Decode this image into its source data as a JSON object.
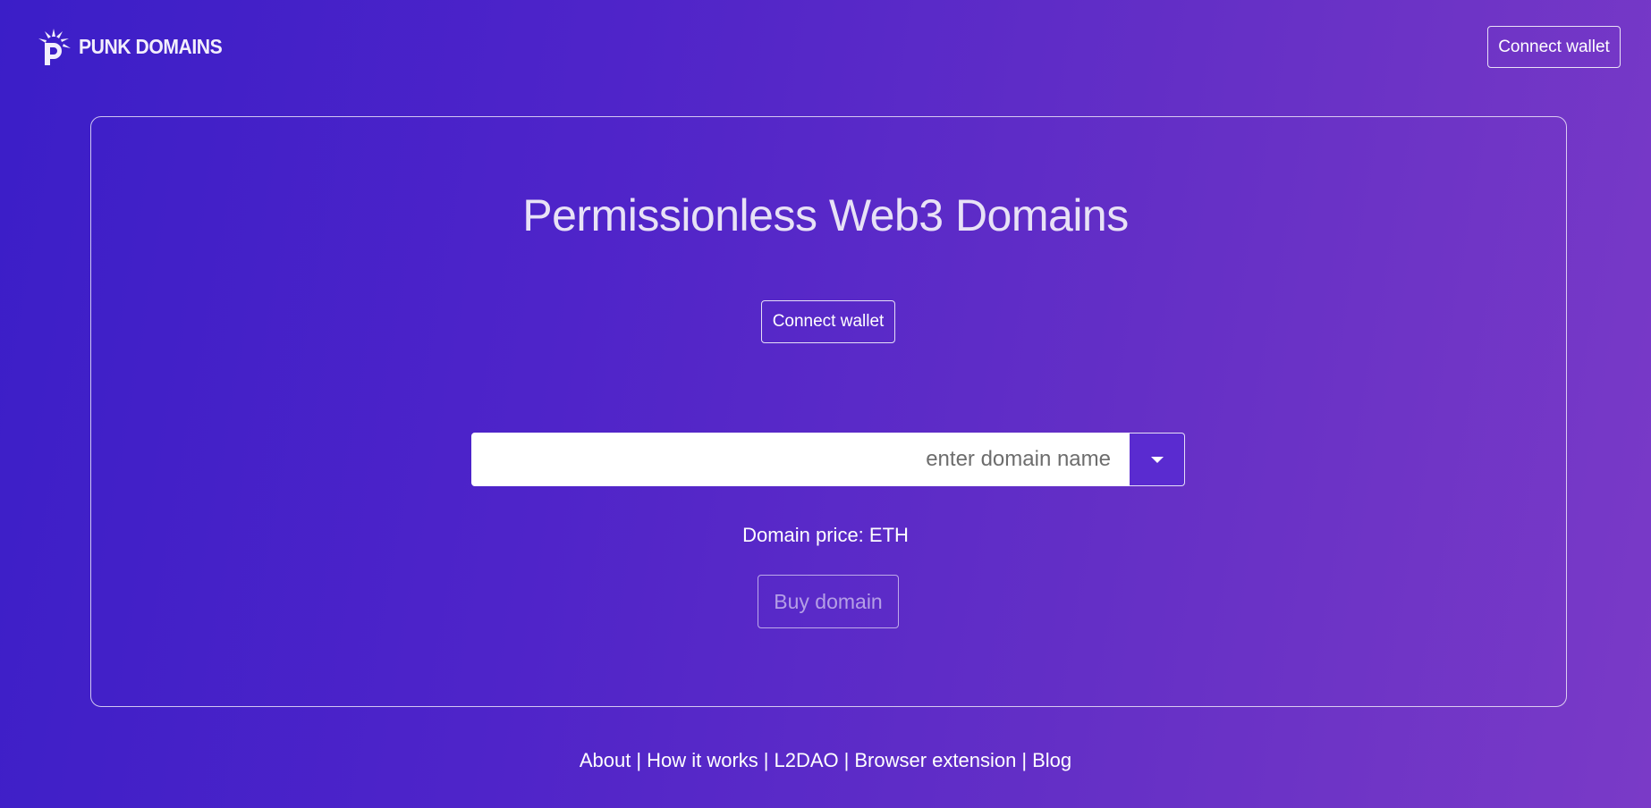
{
  "navbar": {
    "brand_name": "PUNK DOMAINS",
    "logo_icon": "punk-logo-icon",
    "connect_label": "Connect wallet"
  },
  "main": {
    "title": "Permissionless Web3 Domains",
    "connect_label": "Connect wallet",
    "domain_input": {
      "value": "",
      "placeholder": "enter domain name"
    },
    "tld_dropdown_icon": "caret-down-icon",
    "price_label": "Domain price:",
    "price_currency": "ETH",
    "buy_label": "Buy domain"
  },
  "footer": {
    "links": [
      {
        "label": "About"
      },
      {
        "label": "How it works"
      },
      {
        "label": "L2DAO"
      },
      {
        "label": "Browser extension"
      },
      {
        "label": "Blog"
      }
    ],
    "separator": "|"
  },
  "colors": {
    "background_start": "#3b1ec8",
    "background_end": "#7a3ac7",
    "input_background": "#ffffff",
    "text": "#ffffff"
  }
}
